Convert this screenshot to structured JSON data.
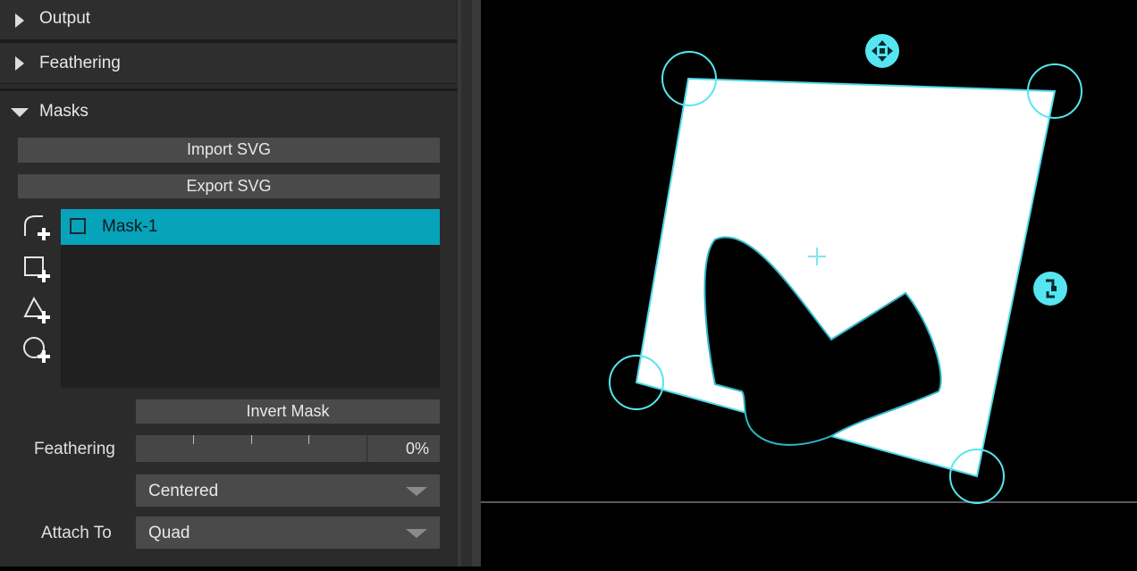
{
  "sections": {
    "output": {
      "label": "Output",
      "expanded": false
    },
    "feathering": {
      "label": "Feathering",
      "expanded": false
    },
    "masks": {
      "label": "Masks",
      "expanded": true
    }
  },
  "masks_panel": {
    "import_svg_label": "Import SVG",
    "export_svg_label": "Export SVG",
    "tools": [
      "add-bezier-mask-icon",
      "add-rectangle-mask-icon",
      "add-polygon-mask-icon",
      "add-ellipse-mask-icon"
    ],
    "mask_list": [
      {
        "name": "Mask-1",
        "selected": true,
        "checked": false
      }
    ],
    "invert_mask_label": "Invert Mask",
    "feathering_label": "Feathering",
    "feathering_value": "0%",
    "feather_mode": "Centered",
    "attach_to_label": "Attach To",
    "attach_to_value": "Quad"
  },
  "colors": {
    "accent": "#07a3ba",
    "handle": "#55e6f2",
    "panel_bg": "#2b2b2b",
    "button_bg": "#4a4a4a",
    "list_bg": "#202020"
  },
  "viewport": {
    "handles": [
      "corner-handle",
      "corner-handle",
      "corner-handle",
      "corner-handle",
      "move-handle-icon",
      "rotate-handle-icon",
      "center-crosshair-icon"
    ]
  }
}
